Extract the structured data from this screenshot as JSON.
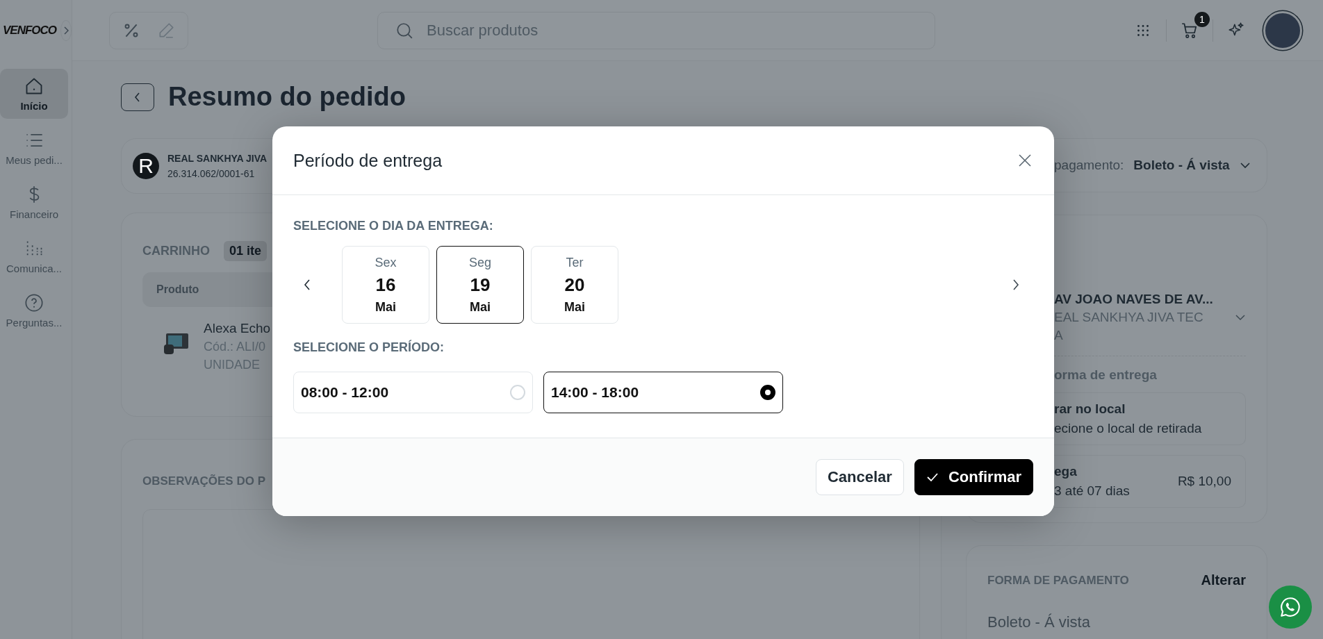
{
  "header": {
    "logo": "VENFOCO",
    "search": {
      "placeholder": "Buscar produtos"
    },
    "cart_badge": "1"
  },
  "sidebar": {
    "items": [
      {
        "label": "Início",
        "kind": "home",
        "selected": true
      },
      {
        "label": "Meus pedi...",
        "kind": "list",
        "selected": false
      },
      {
        "label": "Financeiro",
        "kind": "dollar",
        "selected": false
      },
      {
        "label": "Comunica...",
        "kind": "dots",
        "selected": false
      },
      {
        "label": "Perguntas...",
        "kind": "help",
        "selected": false
      }
    ]
  },
  "page": {
    "title": "Resumo do pedido"
  },
  "customer": {
    "initial": "R",
    "name": "REAL SANKHYA JIVA",
    "document": "26.314.062/0001-61"
  },
  "payment_select": {
    "label": "pagamento:",
    "value": "Boleto - Á vista"
  },
  "cart": {
    "title": "CARRINHO",
    "count": "01 ite",
    "column_1": "Produto",
    "items": [
      {
        "name": "Alexa Echo",
        "code": "Cód.: ALI/0",
        "unit": "UNIDADE"
      }
    ]
  },
  "notes": {
    "title": "OBSERVAÇÕES DO P"
  },
  "delivery": {
    "address": "AV JOAO NAVES DE AV...",
    "recipient_lines": [
      "EAL SANKHYA JIVA TEC",
      "A"
    ],
    "method_label": "orma de entrega",
    "options": [
      {
        "title": "rar no local",
        "subtitle": "ecione o local de retirada"
      },
      {
        "title": "ega",
        "subtitle": "3 até 07 dias",
        "price": "R$ 10,00"
      }
    ]
  },
  "payment": {
    "title": "FORMA DE PAGAMENTO",
    "action": "Alterar",
    "value": "Boleto - Á vista"
  },
  "modal": {
    "title": "Período de entrega",
    "day_label": "SELECIONE O DIA DA ENTREGA:",
    "days": [
      {
        "weekday": "Sex",
        "day": "16",
        "month": "Mai",
        "selected": false
      },
      {
        "weekday": "Seg",
        "day": "19",
        "month": "Mai",
        "selected": true
      },
      {
        "weekday": "Ter",
        "day": "20",
        "month": "Mai",
        "selected": false
      }
    ],
    "period_label": "SELECIONE O PERÍODO:",
    "periods": [
      {
        "label": "08:00 - 12:00",
        "selected": false
      },
      {
        "label": "14:00 - 18:00",
        "selected": true
      }
    ],
    "buttons": [
      {
        "label": "Cancelar",
        "kind": "secondary"
      },
      {
        "label": "Confirmar",
        "kind": "primary"
      }
    ]
  }
}
